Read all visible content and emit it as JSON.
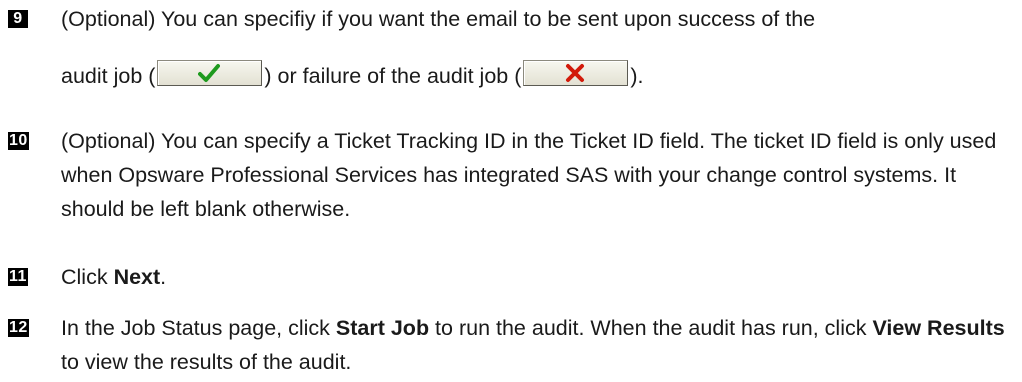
{
  "steps": [
    {
      "number": "9",
      "text_a": "(Optional) You can specifiy if you want the email to be sent upon success of the",
      "text_b": "audit job (",
      "text_c": ") or failure of the audit job (",
      "text_d": ")."
    },
    {
      "number": "10",
      "text": "(Optional) You can specify a Ticket Tracking ID in the Ticket ID field. The ticket ID field is only used when Opsware Professional Services has integrated SAS with your change control systems. It should be left blank otherwise."
    },
    {
      "number": "11",
      "pre": "Click ",
      "bold": "Next",
      "post": "."
    },
    {
      "number": "12",
      "pre": "In the Job Status page, click ",
      "bold1": "Start Job",
      "mid": " to run the audit. When the audit has run, click ",
      "bold2": "View Results",
      "post": " to view the results of the audit."
    }
  ],
  "icons": {
    "success_button": "checkmark-icon",
    "failure_button": "x-icon",
    "success_color": "#1e9a1e",
    "failure_color": "#d21a0a"
  }
}
